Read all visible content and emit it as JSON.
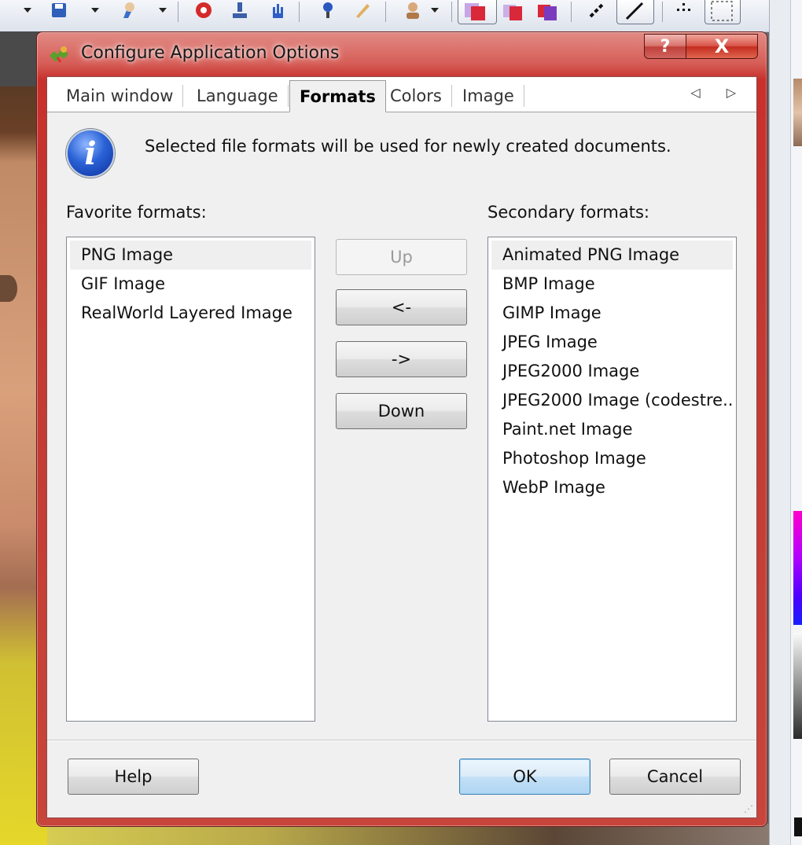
{
  "dialog": {
    "title": "Configure Application Options",
    "help_caption": "?",
    "close_caption": "X"
  },
  "tabs": [
    {
      "label": "Main window"
    },
    {
      "label": "Language"
    },
    {
      "label": "Formats"
    },
    {
      "label": "Colors"
    },
    {
      "label": "Image"
    }
  ],
  "active_tab": "Formats",
  "tab_scroll": "◁ ▷",
  "info": {
    "icon": "info-icon",
    "text": "Selected file formats will be used for newly created documents."
  },
  "favorite": {
    "label": "Favorite formats:",
    "items": [
      "PNG Image",
      "GIF Image",
      "RealWorld Layered Image"
    ],
    "selected": "PNG Image"
  },
  "secondary": {
    "label": "Secondary formats:",
    "items": [
      "Animated PNG Image",
      "BMP Image",
      "GIMP Image",
      "JPEG Image",
      "JPEG2000 Image",
      "JPEG2000 Image (codestre...",
      "Paint.net Image",
      "Photoshop Image",
      "WebP Image"
    ],
    "selected": "Animated PNG Image"
  },
  "move_buttons": {
    "up": "Up",
    "left": "<-",
    "right": "->",
    "down": "Down"
  },
  "footer": {
    "help": "Help",
    "ok": "OK",
    "cancel": "Cancel"
  },
  "colors": {
    "title_bar": "#c8302c",
    "client": "#f0f0f0",
    "default_button": "#b0d5f2"
  }
}
